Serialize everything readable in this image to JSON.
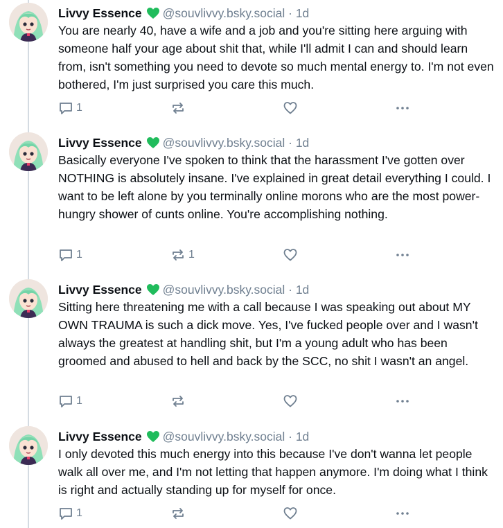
{
  "colors": {
    "badge_green": "#20bc5c",
    "muted_text": "#6f7f90",
    "thread_line": "#d4dbe2"
  },
  "posts": [
    {
      "author": "Livvy Essence",
      "verified_icon": "heart-badge-icon",
      "handle": "@souvlivvy.bsky.social",
      "separator": "·",
      "time": "1d",
      "text": "You are nearly 40, have a wife and a job and you're sitting here arguing with someone half your age about shit that, while I'll admit I can and should learn from, isn't something you need to devote so much mental energy to. I'm not even bothered, I'm just surprised you care this much.",
      "reply_count": "1",
      "repost_count": "",
      "like_count": ""
    },
    {
      "author": "Livvy Essence",
      "verified_icon": "heart-badge-icon",
      "handle": "@souvlivvy.bsky.social",
      "separator": "·",
      "time": "1d",
      "text": "Basically everyone I've spoken to think that the harassment I've gotten over NOTHING is absolutely insane. I've explained in great detail everything I could. I want to be left alone by you terminally online morons who are the most power-hungry shower of cunts online. You're accomplishing nothing.",
      "reply_count": "1",
      "repost_count": "1",
      "like_count": ""
    },
    {
      "author": "Livvy Essence",
      "verified_icon": "heart-badge-icon",
      "handle": "@souvlivvy.bsky.social",
      "separator": "·",
      "time": "1d",
      "text": "Sitting here threatening me with a call because I was speaking out about MY OWN TRAUMA is such a dick move. Yes, I've fucked people over and I wasn't always the greatest at handling shit, but I'm a young adult who has been groomed and abused to hell and back by the SCC, no shit I wasn't an angel.",
      "reply_count": "1",
      "repost_count": "",
      "like_count": ""
    },
    {
      "author": "Livvy Essence",
      "verified_icon": "heart-badge-icon",
      "handle": "@souvlivvy.bsky.social",
      "separator": "·",
      "time": "1d",
      "text": "I only devoted this much energy into this because I've don't wanna let people walk all over me, and I'm not letting that happen anymore. I'm doing what I think is right and actually standing up for myself for once.",
      "reply_count": "1",
      "repost_count": "",
      "like_count": ""
    }
  ]
}
